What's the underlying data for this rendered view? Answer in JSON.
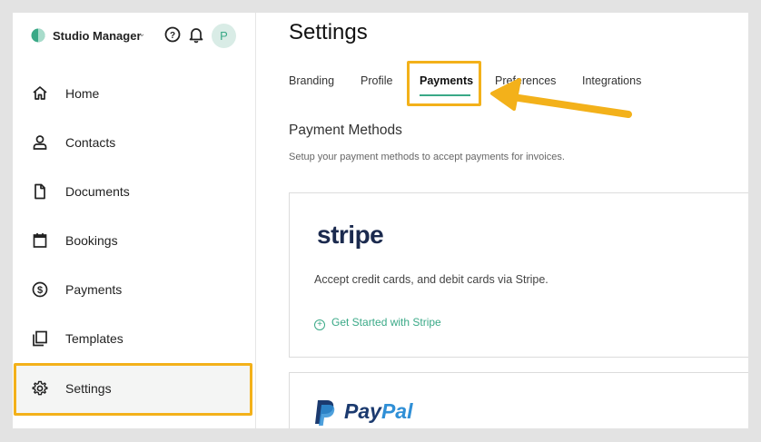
{
  "header": {
    "studio_name": "Studio Manager",
    "avatar_letter": "P"
  },
  "sidebar": {
    "items": [
      {
        "label": "Home",
        "icon": "home-icon"
      },
      {
        "label": "Contacts",
        "icon": "user-icon"
      },
      {
        "label": "Documents",
        "icon": "document-icon"
      },
      {
        "label": "Bookings",
        "icon": "calendar-icon"
      },
      {
        "label": "Payments",
        "icon": "dollar-circle-icon"
      },
      {
        "label": "Templates",
        "icon": "templates-icon"
      },
      {
        "label": "Settings",
        "icon": "gear-icon",
        "active": true
      }
    ]
  },
  "main": {
    "title": "Settings",
    "tabs": [
      {
        "label": "Branding"
      },
      {
        "label": "Profile"
      },
      {
        "label": "Payments",
        "active": true
      },
      {
        "label": "Preferences"
      },
      {
        "label": "Integrations"
      }
    ],
    "section_title": "Payment Methods",
    "section_subtitle": "Setup your payment methods to accept payments for invoices.",
    "stripe": {
      "logo_text": "stripe",
      "description": "Accept credit cards, and debit cards via Stripe.",
      "cta": "Get Started with Stripe"
    },
    "paypal": {
      "logo_pay": "Pay",
      "logo_pal": "Pal"
    }
  },
  "colors": {
    "accent": "#3aa987",
    "highlight": "#f3b11a",
    "stripe_navy": "#1b2a4e",
    "paypal_dark": "#1b3a6f",
    "paypal_light": "#2f8fd6"
  }
}
